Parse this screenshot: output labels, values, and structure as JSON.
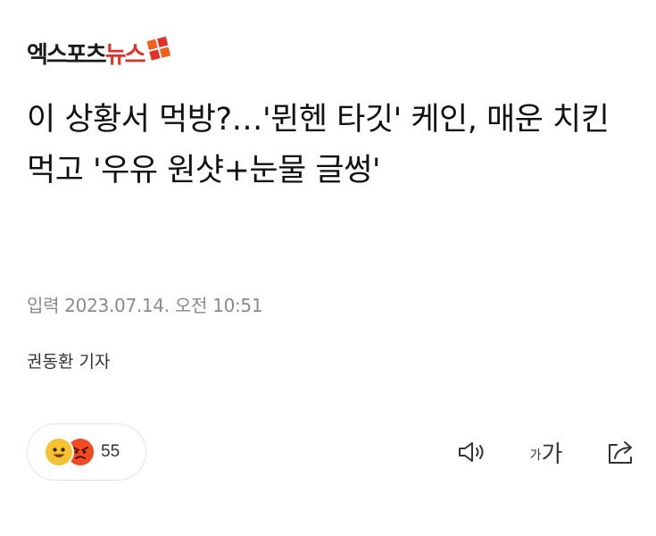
{
  "logo": {
    "part1": "엑스포츠",
    "part2": "뉴스"
  },
  "article": {
    "headline": "이 상황서 먹방?…'뮌헨 타깃' 케인, 매운 치킨 먹고 '우유 원샷+눈물 글썽'",
    "published": "입력 2023.07.14. 오전 10:51",
    "reporter": "권동환 기자"
  },
  "reactions": {
    "count": "55",
    "icons": [
      "smile-emoji-icon",
      "angry-emoji-icon"
    ]
  },
  "toolbar": {
    "font_small": "가",
    "font_large": "가",
    "icons": [
      "speaker-icon",
      "font-size-icon",
      "share-icon"
    ]
  },
  "colors": {
    "brand_red": "#e0302a",
    "brand_orange": "#f0611e",
    "meta_gray": "#8a8a8a",
    "emoji_yellow": "#f7c232",
    "emoji_red": "#f04a22"
  }
}
